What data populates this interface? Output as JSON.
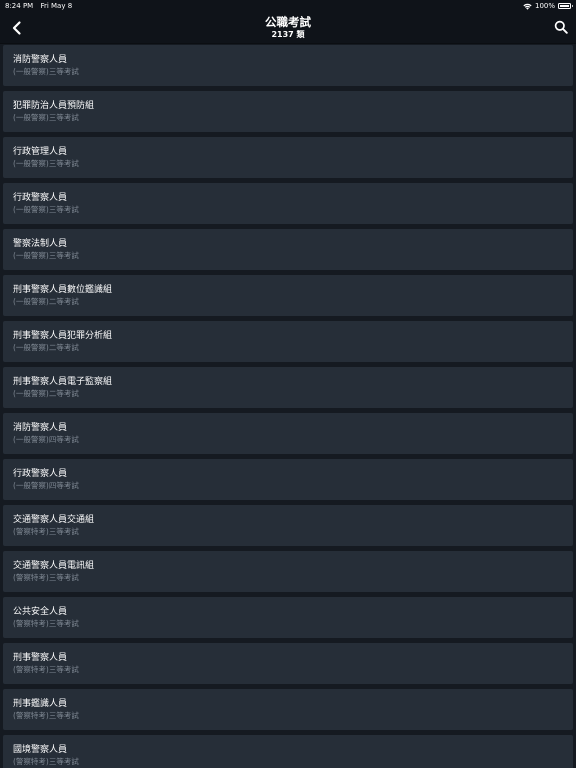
{
  "status_bar": {
    "time": "8:24 PM",
    "date": "Fri May 8",
    "battery": "100%",
    "battery_level": 1.0
  },
  "nav": {
    "title": "公職考試",
    "subtitle": "2137 類",
    "back_icon": "chevron-left-icon",
    "search_icon": "search-icon"
  },
  "items": [
    {
      "title": "消防警察人員",
      "subtitle": "(一般警察)三等考試"
    },
    {
      "title": "犯罪防治人員預防組",
      "subtitle": "(一般警察)三等考試"
    },
    {
      "title": "行政管理人員",
      "subtitle": "(一般警察)三等考試"
    },
    {
      "title": "行政警察人員",
      "subtitle": "(一般警察)三等考試"
    },
    {
      "title": "警察法制人員",
      "subtitle": "(一般警察)三等考試"
    },
    {
      "title": "刑事警察人員數位鑑識組",
      "subtitle": "(一般警察)二等考試"
    },
    {
      "title": "刑事警察人員犯罪分析組",
      "subtitle": "(一般警察)二等考試"
    },
    {
      "title": "刑事警察人員電子監察組",
      "subtitle": "(一般警察)二等考試"
    },
    {
      "title": "消防警察人員",
      "subtitle": "(一般警察)四等考試"
    },
    {
      "title": "行政警察人員",
      "subtitle": "(一般警察)四等考試"
    },
    {
      "title": "交通警察人員交通組",
      "subtitle": "(警察特考)三等考試"
    },
    {
      "title": "交通警察人員電訊組",
      "subtitle": "(警察特考)三等考試"
    },
    {
      "title": "公共安全人員",
      "subtitle": "(警察特考)三等考試"
    },
    {
      "title": "刑事警察人員",
      "subtitle": "(警察特考)三等考試"
    },
    {
      "title": "刑事鑑識人員",
      "subtitle": "(警察特考)三等考試"
    },
    {
      "title": "國境警察人員",
      "subtitle": "(警察特考)三等考試"
    }
  ]
}
